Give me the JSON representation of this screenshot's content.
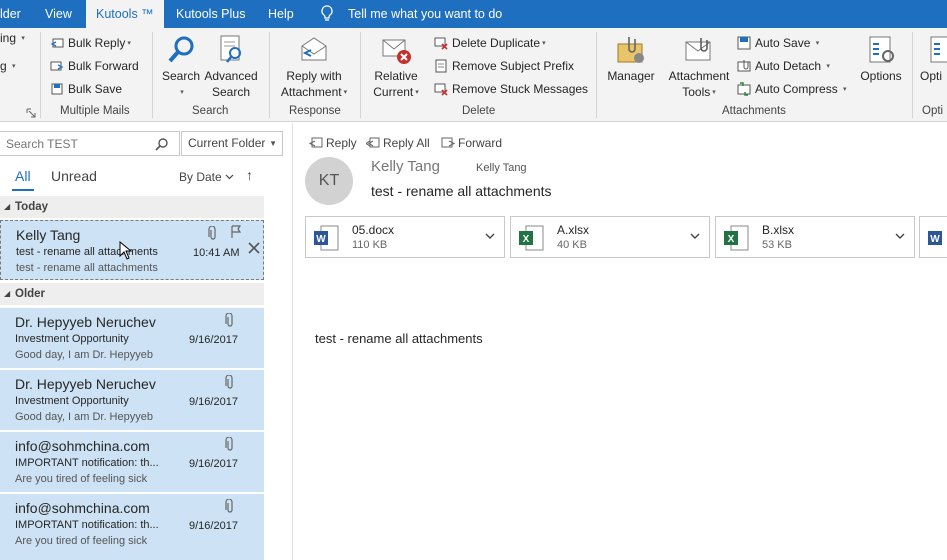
{
  "tabs": {
    "folder": "lder",
    "view": "View",
    "kutools": "Kutools ™",
    "kutools_plus": "Kutools Plus",
    "help": "Help",
    "tell_me": "Tell me what you want to do"
  },
  "ribbon": {
    "left_cut_1": "ing",
    "left_cut_2": "g",
    "multiple_mails": {
      "bulk_reply": "Bulk Reply",
      "bulk_forward": "Bulk Forward",
      "bulk_save": "Bulk Save",
      "label": "Multiple Mails"
    },
    "search": {
      "search": "Search",
      "advanced_1": "Advanced",
      "advanced_2": "Search",
      "label": "Search"
    },
    "response": {
      "reply_with_1": "Reply with",
      "reply_with_2": "Attachment",
      "label": "Response"
    },
    "delete": {
      "relative_1": "Relative",
      "relative_2": "Current",
      "delete_duplicate": "Delete Duplicate",
      "remove_subject_prefix": "Remove Subject Prefix",
      "remove_stuck_messages": "Remove Stuck Messages",
      "label": "Delete"
    },
    "attachments": {
      "manager": "Manager",
      "attachment_tools_1": "Attachment",
      "attachment_tools_2": "Tools",
      "auto_save": "Auto Save",
      "auto_detach": "Auto Detach",
      "auto_compress": "Auto Compress",
      "options": "Options",
      "label": "Attachments"
    },
    "right_cut": "Opti",
    "right_cut_label": "Opti"
  },
  "list": {
    "search_placeholder": "Search TEST",
    "scope": "Current Folder",
    "filter_all": "All",
    "filter_unread": "Unread",
    "sort": "By Date",
    "sort_arrow": "↑",
    "groups": [
      {
        "label": "Today"
      },
      {
        "label": "Older"
      }
    ],
    "items": [
      {
        "from": "Kelly Tang",
        "subject": "test - rename all attachments",
        "preview": "test - rename all attachments",
        "date": "10:41 AM"
      },
      {
        "from": "Dr. Hepyyeb Neruchev",
        "subject": "Investment Opportunity",
        "preview": "Good day,  I am Dr. Hepyyeb",
        "date": "9/16/2017"
      },
      {
        "from": "Dr. Hepyyeb Neruchev",
        "subject": "Investment Opportunity",
        "preview": "Good day,  I am Dr. Hepyyeb",
        "date": "9/16/2017"
      },
      {
        "from": "info@sohmchina.com",
        "subject": "IMPORTANT notification: th...",
        "preview": "Are you tired of feeling sick",
        "date": "9/16/2017"
      },
      {
        "from": "info@sohmchina.com",
        "subject": "IMPORTANT notification: th...",
        "preview": "Are you tired of feeling sick",
        "date": "9/16/2017"
      }
    ]
  },
  "reading": {
    "actions": {
      "reply": "Reply",
      "reply_all": "Reply All",
      "forward": "Forward"
    },
    "avatar": "KT",
    "sender": "Kelly Tang",
    "to": "Kelly Tang",
    "subject": "test - rename all attachments",
    "attachments": [
      {
        "name": "05.docx",
        "size": "110 KB",
        "type": "word"
      },
      {
        "name": "A.xlsx",
        "size": "40 KB",
        "type": "excel"
      },
      {
        "name": "B.xlsx",
        "size": "53 KB",
        "type": "excel"
      }
    ],
    "body": "test - rename all attachments"
  },
  "colors": {
    "accent": "#1e6fc0",
    "selection": "#cde3f5",
    "word": "#2b5797",
    "excel": "#217346"
  }
}
